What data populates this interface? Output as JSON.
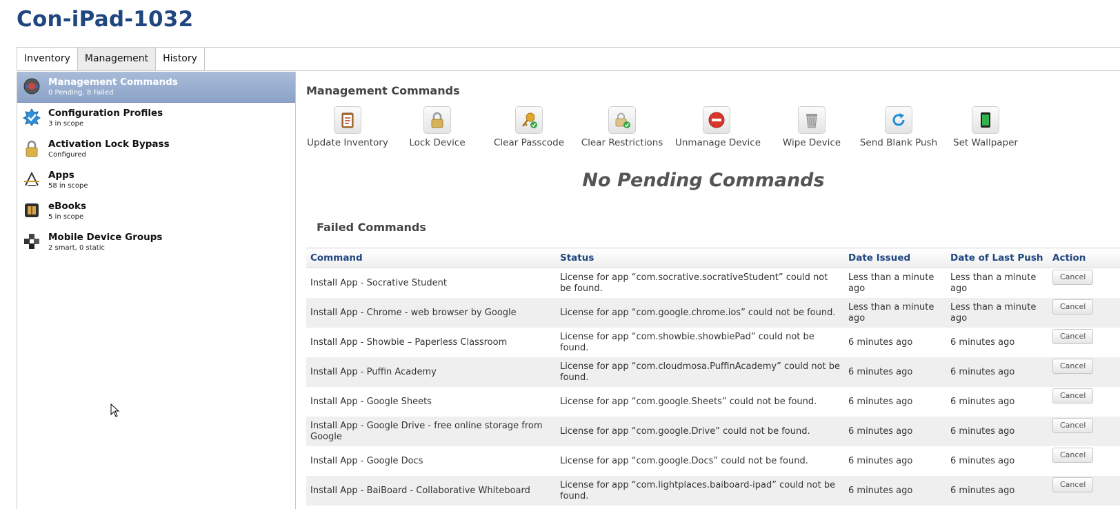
{
  "device_title": "Con-iPad-1032",
  "tabs": [
    {
      "label": "Inventory"
    },
    {
      "label": "Management"
    },
    {
      "label": "History"
    }
  ],
  "sidebar": {
    "items": [
      {
        "label": "Management Commands",
        "sub": "0 Pending, 8 Failed",
        "icon": "management-commands-icon"
      },
      {
        "label": "Configuration Profiles",
        "sub": "3 in scope",
        "icon": "configuration-profile-badge-icon"
      },
      {
        "label": "Activation Lock Bypass",
        "sub": "Configured",
        "icon": "padlock-icon"
      },
      {
        "label": "Apps",
        "sub": "58 in scope",
        "icon": "app-store-icon"
      },
      {
        "label": "eBooks",
        "sub": "5 in scope",
        "icon": "ebook-icon"
      },
      {
        "label": "Mobile Device Groups",
        "sub": "2 smart, 0 static",
        "icon": "groups-icon"
      }
    ]
  },
  "main": {
    "section_title": "Management Commands",
    "commands": [
      {
        "label": "Update Inventory",
        "icon": "clipboard-checklist-icon"
      },
      {
        "label": "Lock Device",
        "icon": "padlock-icon"
      },
      {
        "label": "Clear Passcode",
        "icon": "key-check-icon"
      },
      {
        "label": "Clear Restrictions",
        "icon": "lock-check-icon"
      },
      {
        "label": "Unmanage Device",
        "icon": "no-entry-icon"
      },
      {
        "label": "Wipe Device",
        "icon": "trash-can-icon"
      },
      {
        "label": "Send Blank Push",
        "icon": "refresh-arrow-icon"
      },
      {
        "label": "Set Wallpaper",
        "icon": "tablet-device-icon"
      }
    ],
    "no_pending": "No Pending Commands",
    "failed_title": "Failed Commands",
    "table": {
      "columns": [
        "Command",
        "Status",
        "Date Issued",
        "Date of Last Push",
        "Action"
      ],
      "rows": [
        {
          "command": "Install App - Socrative Student",
          "status": "License for app “com.socrative.socrativeStudent” could not be found.",
          "issued": "Less than a minute ago",
          "last_push": "Less than a minute ago",
          "action": "Cancel"
        },
        {
          "command": "Install App - Chrome - web browser by Google",
          "status": "License for app “com.google.chrome.ios” could not be found.",
          "issued": "Less than a minute ago",
          "last_push": "Less than a minute ago",
          "action": "Cancel"
        },
        {
          "command": "Install App - Showbie – Paperless Classroom",
          "status": "License for app “com.showbie.showbiePad” could not be found.",
          "issued": "6 minutes ago",
          "last_push": "6 minutes ago",
          "action": "Cancel"
        },
        {
          "command": "Install App - Puffin Academy",
          "status": "License for app “com.cloudmosa.PuffinAcademy” could not be found.",
          "issued": "6 minutes ago",
          "last_push": "6 minutes ago",
          "action": "Cancel"
        },
        {
          "command": "Install App - Google Sheets",
          "status": "License for app “com.google.Sheets” could not be found.",
          "issued": "6 minutes ago",
          "last_push": "6 minutes ago",
          "action": "Cancel"
        },
        {
          "command": "Install App - Google Drive - free online storage from Google",
          "status": "License for app “com.google.Drive” could not be found.",
          "issued": "6 minutes ago",
          "last_push": "6 minutes ago",
          "action": "Cancel"
        },
        {
          "command": "Install App - Google Docs",
          "status": "License for app “com.google.Docs” could not be found.",
          "issued": "6 minutes ago",
          "last_push": "6 minutes ago",
          "action": "Cancel"
        },
        {
          "command": "Install App - BaiBoard - Collaborative Whiteboard",
          "status": "License for app “com.lightplaces.baiboard-ipad” could not be found.",
          "issued": "6 minutes ago",
          "last_push": "6 minutes ago",
          "action": "Cancel"
        }
      ]
    }
  },
  "colors": {
    "title": "#20467f",
    "selected_sidebar": "#8ba3c8",
    "error_red": "#d9362b"
  }
}
